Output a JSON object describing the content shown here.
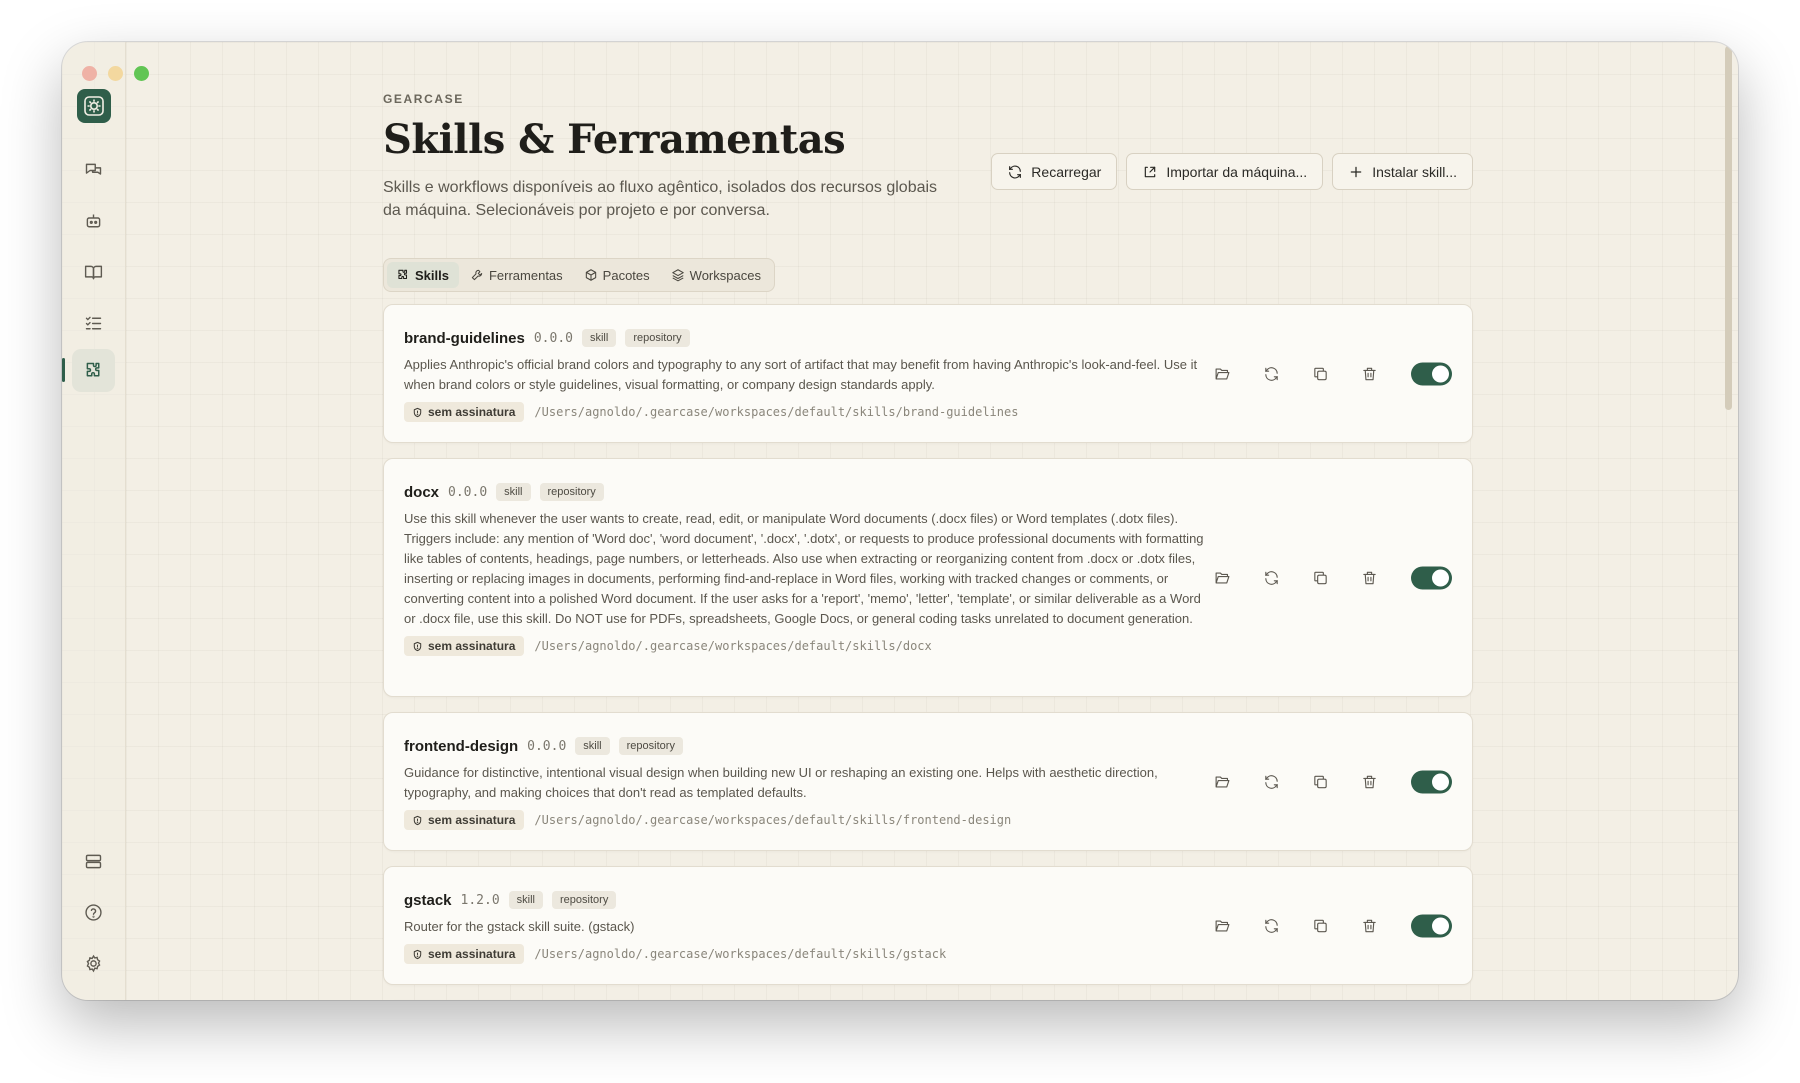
{
  "window": {
    "app_label": "GEARCASE",
    "title": "Skills & Ferramentas",
    "subtitle": "Skills e workflows disponíveis ao fluxo agêntico, isolados dos recursos globais da máquina. Selecionáveis por projeto e por conversa."
  },
  "sidebar": {
    "items": [
      {
        "name": "chat",
        "icon": "chat-bubbles-icon",
        "active": false
      },
      {
        "name": "agents",
        "icon": "robot-icon",
        "active": false
      },
      {
        "name": "library",
        "icon": "book-icon",
        "active": false
      },
      {
        "name": "tasks",
        "icon": "checklist-icon",
        "active": false
      },
      {
        "name": "skills",
        "icon": "puzzle-icon",
        "active": true
      }
    ],
    "bottom": [
      {
        "name": "storage",
        "icon": "server-icon"
      },
      {
        "name": "help",
        "icon": "help-icon"
      },
      {
        "name": "settings",
        "icon": "gear-icon"
      }
    ]
  },
  "actions": {
    "reload": "Recarregar",
    "import": "Importar da máquina...",
    "install": "Instalar skill..."
  },
  "tabs": [
    {
      "label": "Skills",
      "icon": "puzzle-icon",
      "active": true
    },
    {
      "label": "Ferramentas",
      "icon": "wrench-icon",
      "active": false
    },
    {
      "label": "Pacotes",
      "icon": "package-icon",
      "active": false
    },
    {
      "label": "Workspaces",
      "icon": "layers-icon",
      "active": false
    }
  ],
  "skills": [
    {
      "name": "brand-guidelines",
      "version": "0.0.0",
      "type": "skill",
      "source": "repository",
      "description": "Applies Anthropic's official brand colors and typography to any sort of artifact that may benefit from having Anthropic's look-and-feel. Use it when brand colors or style guidelines, visual formatting, or company design standards apply.",
      "signature": "sem assinatura",
      "path": "/Users/agnoldo/.gearcase/workspaces/default/skills/brand-guidelines",
      "enabled": true
    },
    {
      "name": "docx",
      "version": "0.0.0",
      "type": "skill",
      "source": "repository",
      "description": "Use this skill whenever the user wants to create, read, edit, or manipulate Word documents (.docx files) or Word templates (.dotx files). Triggers include: any mention of 'Word doc', 'word document', '.docx', '.dotx', or requests to produce professional documents with formatting like tables of contents, headings, page numbers, or letterheads. Also use when extracting or reorganizing content from .docx or .dotx files, inserting or replacing images in documents, performing find-and-replace in Word files, working with tracked changes or comments, or converting content into a polished Word document. If the user asks for a 'report', 'memo', 'letter', 'template', or similar deliverable as a Word or .docx file, use this skill. Do NOT use for PDFs, spreadsheets, Google Docs, or general coding tasks unrelated to document generation.",
      "signature": "sem assinatura",
      "path": "/Users/agnoldo/.gearcase/workspaces/default/skills/docx",
      "enabled": true
    },
    {
      "name": "frontend-design",
      "version": "0.0.0",
      "type": "skill",
      "source": "repository",
      "description": "Guidance for distinctive, intentional visual design when building new UI or reshaping an existing one. Helps with aesthetic direction, typography, and making choices that don't read as templated defaults.",
      "signature": "sem assinatura",
      "path": "/Users/agnoldo/.gearcase/workspaces/default/skills/frontend-design",
      "enabled": true
    },
    {
      "name": "gstack",
      "version": "1.2.0",
      "type": "skill",
      "source": "repository",
      "description": "Router for the gstack skill suite. (gstack)",
      "signature": "sem assinatura",
      "path": "/Users/agnoldo/.gearcase/workspaces/default/skills/gstack",
      "enabled": true
    }
  ],
  "colors": {
    "accent": "#2f5e4a",
    "background": "#f3efe5",
    "card": "#fcfbf7"
  }
}
